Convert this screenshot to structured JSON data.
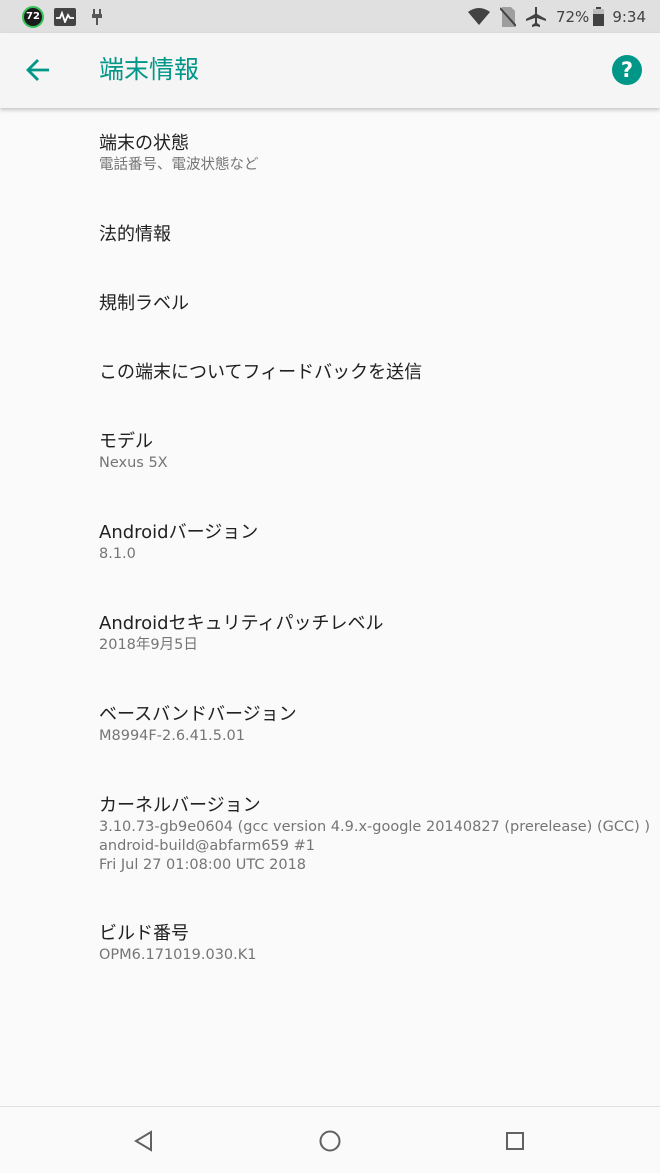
{
  "status_bar": {
    "notification_badge": "72",
    "battery": "72%",
    "time": "9:34",
    "icons": [
      "activity-monitor-icon",
      "usb-debug-icon",
      "wifi-icon",
      "no-sim-icon",
      "airplane-mode-icon",
      "battery-icon"
    ]
  },
  "app_bar": {
    "title": "端末情報",
    "help": "?"
  },
  "items": {
    "device_status": {
      "title": "端末の状態",
      "summary": "電話番号、電波状態など"
    },
    "legal_info": {
      "title": "法的情報"
    },
    "regulatory_labels": {
      "title": "規制ラベル"
    },
    "send_feedback": {
      "title": "この端末についてフィードバックを送信"
    },
    "model": {
      "title": "モデル",
      "summary": "Nexus 5X"
    },
    "android_version": {
      "title": "Androidバージョン",
      "summary": "8.1.0"
    },
    "security_patch": {
      "title": "Androidセキュリティパッチレベル",
      "summary": "2018年9月5日"
    },
    "baseband": {
      "title": "ベースバンドバージョン",
      "summary": "M8994F-2.6.41.5.01"
    },
    "kernel": {
      "title": "カーネルバージョン",
      "summary_lines": [
        "3.10.73-gb9e0604 (gcc version 4.9.x-google 20140827 (prerelease) (GCC) )",
        "android-build@abfarm659 #1",
        "Fri Jul 27 01:08:00 UTC 2018"
      ]
    },
    "build_number": {
      "title": "ビルド番号",
      "summary": "OPM6.171019.030.K1"
    }
  },
  "colors": {
    "accent": "#009688",
    "status_bar": "#e0e0e0",
    "background": "#fafafa",
    "secondary_text": "#757575"
  }
}
